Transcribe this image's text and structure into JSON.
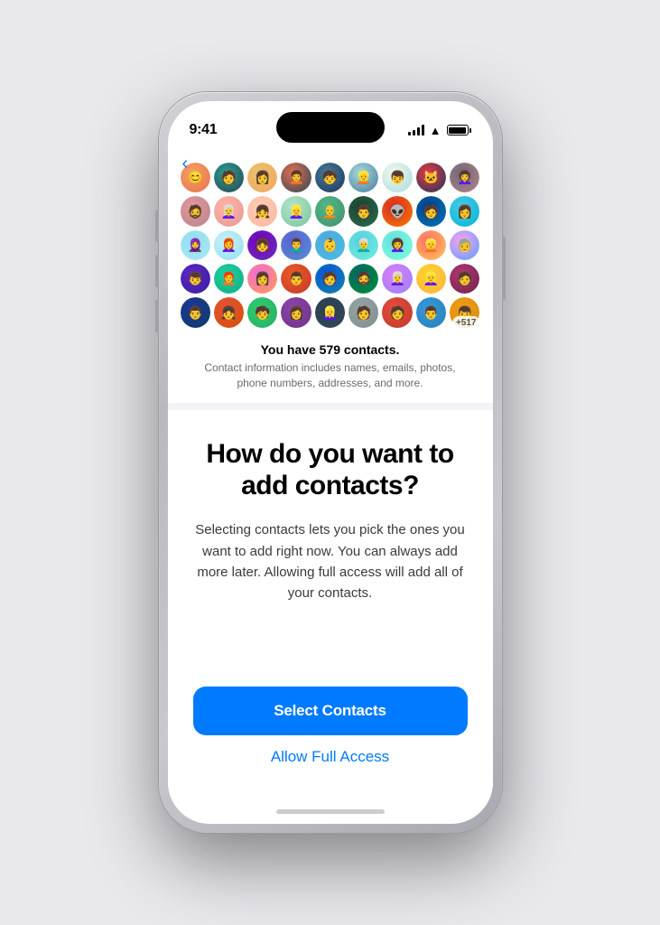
{
  "status_bar": {
    "time": "9:41"
  },
  "back_button": {
    "label": "‹"
  },
  "contacts_grid": {
    "more_label": "+517",
    "avatars": [
      {
        "color": "#e8b4a0",
        "emoji": "😊"
      },
      {
        "color": "#c4a882",
        "emoji": "🧑"
      },
      {
        "color": "#f4c2c2",
        "emoji": "👩"
      },
      {
        "color": "#d4a0c0",
        "emoji": "🧑‍🦱"
      },
      {
        "color": "#f0d080",
        "emoji": "👤"
      },
      {
        "color": "#b8d4f0",
        "emoji": "👱"
      },
      {
        "color": "#d0e8b0",
        "emoji": "🧒"
      },
      {
        "color": "#f0b080",
        "emoji": "👦"
      },
      {
        "color": "#e0c090",
        "emoji": "🐱"
      },
      {
        "color": "#908070",
        "emoji": "👩‍🦱"
      },
      {
        "color": "#d4b090",
        "emoji": "🧔"
      },
      {
        "color": "#b0c8e0",
        "emoji": "🧑"
      },
      {
        "color": "#e8c0d0",
        "emoji": "👩‍🦳"
      },
      {
        "color": "#c0d0b0",
        "emoji": "👧"
      },
      {
        "color": "#f0b8c0",
        "emoji": "👱‍♀️"
      },
      {
        "color": "#c0a0e0",
        "emoji": "🧑‍🦲"
      },
      {
        "color": "#80a0c0",
        "emoji": "👨"
      },
      {
        "color": "#303030",
        "emoji": "👽"
      },
      {
        "color": "#e0a870",
        "emoji": "🧑"
      },
      {
        "color": "#b0d0a0",
        "emoji": "👩"
      },
      {
        "color": "#d0b8e8",
        "emoji": "🧕"
      },
      {
        "color": "#f4a0a0",
        "emoji": "👩‍🦰"
      },
      {
        "color": "#80c0a0",
        "emoji": "🧑"
      },
      {
        "color": "#e8d090",
        "emoji": "👧"
      },
      {
        "color": "#c090b0",
        "emoji": "👨‍🦱"
      },
      {
        "color": "#a0b8d0",
        "emoji": "🧑"
      },
      {
        "color": "#e0c0a0",
        "emoji": "👩"
      },
      {
        "color": "#b0e0c0",
        "emoji": "👶"
      },
      {
        "color": "#d0a0a0",
        "emoji": "👨‍🦳"
      },
      {
        "color": "#c0d8f0",
        "emoji": "🧑"
      },
      {
        "color": "#f0c8a0",
        "emoji": "👩‍🦱"
      },
      {
        "color": "#a0c8a0",
        "emoji": "👱"
      },
      {
        "color": "#e0b0d0",
        "emoji": "🧓"
      },
      {
        "color": "#b8c0a0",
        "emoji": "👦"
      },
      {
        "color": "#d0a8c0",
        "emoji": "🧑‍🦰"
      },
      {
        "color": "#f0d8b0",
        "emoji": "👩"
      },
      {
        "color": "#a0b0c0",
        "emoji": "👨"
      },
      {
        "color": "#c8a0b0",
        "emoji": "🧑"
      },
      {
        "color": "#b0c0a8",
        "emoji": "👧"
      },
      {
        "color": "#e0b890",
        "emoji": "🧔"
      },
      {
        "color": "#c0a8d0",
        "emoji": "👩‍🦳"
      },
      {
        "color": "#90b0c0",
        "emoji": "👱‍♀️"
      },
      {
        "color": "#d8a080",
        "emoji": "🧑"
      },
      {
        "color": "#b0d0b8",
        "emoji": "👨"
      },
      {
        "color": "#e8c0b0",
        "emoji": "🧒"
      }
    ]
  },
  "contacts_info": {
    "count_bold": "You have 579 contacts.",
    "description": "Contact information includes names, emails, photos, phone numbers, addresses, and more."
  },
  "main_content": {
    "title": "How do you want to add contacts?",
    "description": "Selecting contacts lets you pick the ones you want to add right now. You can always add more later. Allowing full access will add all of your contacts."
  },
  "buttons": {
    "select_contacts": "Select Contacts",
    "allow_full_access": "Allow Full Access"
  },
  "colors": {
    "accent": "#007AFF"
  }
}
